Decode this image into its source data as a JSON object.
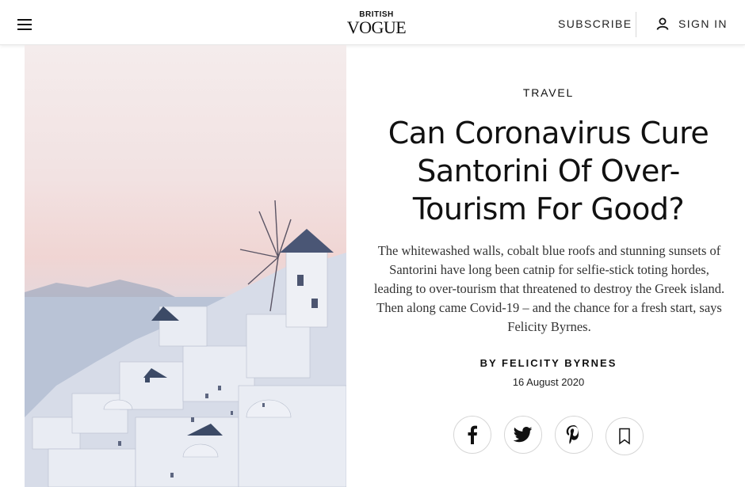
{
  "header": {
    "logo_top": "BRITISH",
    "logo_main": "VOGUE",
    "subscribe_label": "SUBSCRIBE",
    "signin_label": "SIGN IN"
  },
  "article": {
    "section": "TRAVEL",
    "headline": "Can Coronavirus Cure Santorini Of Over-Tourism For Good?",
    "dek": "The whitewashed walls, cobalt blue roofs and stunning sunsets of Santorini have long been catnip for selfie-stick toting hordes, leading to over-tourism that threatened to destroy the Greek island. Then along came Covid-19 – and the chance for a fresh start, says Felicity Byrnes.",
    "byline": "BY FELICITY BYRNES",
    "date": "16 August 2020"
  },
  "share": {
    "icons": [
      "facebook-icon",
      "twitter-icon",
      "pinterest-icon",
      "bookmark-icon"
    ]
  },
  "colors": {
    "text": "#111111",
    "sky_top": "#f4ecec",
    "sky_pink": "#f0d5d3",
    "sea": "#aebbcf",
    "roof_blue": "#3c4a66"
  }
}
